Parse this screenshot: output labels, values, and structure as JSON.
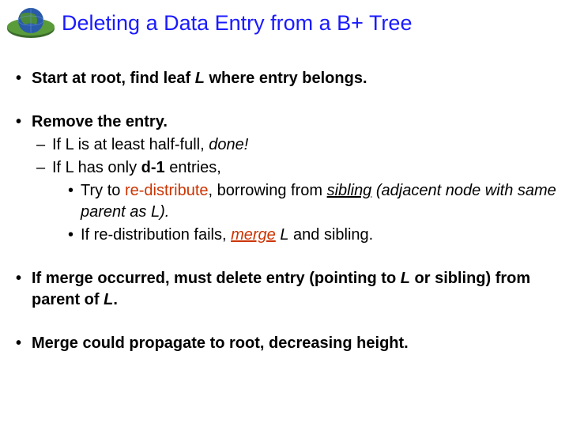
{
  "title": "Deleting a Data Entry from a B+ Tree",
  "b1_a": "Start at root, find leaf ",
  "b1_b": "L",
  "b1_c": " where entry belongs.",
  "b2": "Remove the entry.",
  "b2s1_a": "If L is at least half-full, ",
  "b2s1_b": "done!",
  "b2s2_a": "If L has only ",
  "b2s2_b": "d-1",
  "b2s2_c": " entries,",
  "b2s2i_a": "Try to ",
  "b2s2i_b": "re-distribute",
  "b2s2i_c": ", borrowing from ",
  "b2s2i_d": "sibling",
  "b2s2i_e": " (adjacent node with same parent as L).",
  "b2s2ii_a": "If re-distribution fails, ",
  "b2s2ii_b": "merge",
  "b2s2ii_c": " L",
  "b2s2ii_d": " and sibling.",
  "b3_a": "If merge occurred, must delete entry (pointing to ",
  "b3_b": "L",
  "b3_c": " or sibling) from parent of ",
  "b3_d": "L",
  "b3_e": ".",
  "b4": "Merge could propagate to root, decreasing height."
}
